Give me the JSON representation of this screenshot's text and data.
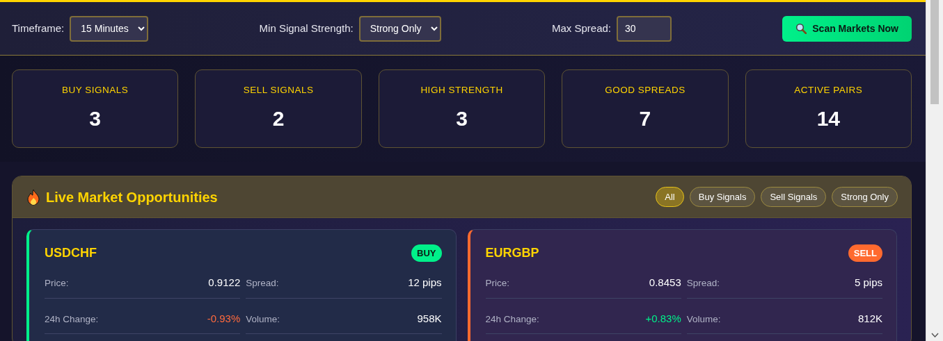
{
  "controls": {
    "timeframe": {
      "label": "Timeframe:",
      "value": "15 Minutes"
    },
    "strength": {
      "label": "Min Signal Strength:",
      "value": "Strong Only"
    },
    "spread": {
      "label": "Max Spread:",
      "value": "30"
    },
    "scan_button": "Scan Markets Now"
  },
  "stats": [
    {
      "label": "BUY SIGNALS",
      "value": "3"
    },
    {
      "label": "SELL SIGNALS",
      "value": "2"
    },
    {
      "label": "HIGH STRENGTH",
      "value": "3"
    },
    {
      "label": "GOOD SPREADS",
      "value": "7"
    },
    {
      "label": "ACTIVE PAIRS",
      "value": "14"
    }
  ],
  "panel": {
    "title": "Live Market Opportunities",
    "filters": [
      {
        "label": "All",
        "selected": true
      },
      {
        "label": "Buy Signals",
        "selected": false
      },
      {
        "label": "Sell Signals",
        "selected": false
      },
      {
        "label": "Strong Only",
        "selected": false
      }
    ],
    "cards": [
      {
        "pair": "USDCHF",
        "signal": "BUY",
        "kind": "buy",
        "rows": [
          [
            {
              "label": "Price:",
              "value": "0.9122"
            },
            {
              "label": "Spread:",
              "value": "12 pips"
            }
          ],
          [
            {
              "label": "24h Change:",
              "value": "-0.93%",
              "kind": "down"
            },
            {
              "label": "Volume:",
              "value": "958K"
            }
          ]
        ]
      },
      {
        "pair": "EURGBP",
        "signal": "SELL",
        "kind": "sell",
        "rows": [
          [
            {
              "label": "Price:",
              "value": "0.8453"
            },
            {
              "label": "Spread:",
              "value": "5 pips"
            }
          ],
          [
            {
              "label": "24h Change:",
              "value": "+0.83%",
              "kind": "up"
            },
            {
              "label": "Volume:",
              "value": "812K"
            }
          ]
        ]
      }
    ]
  }
}
